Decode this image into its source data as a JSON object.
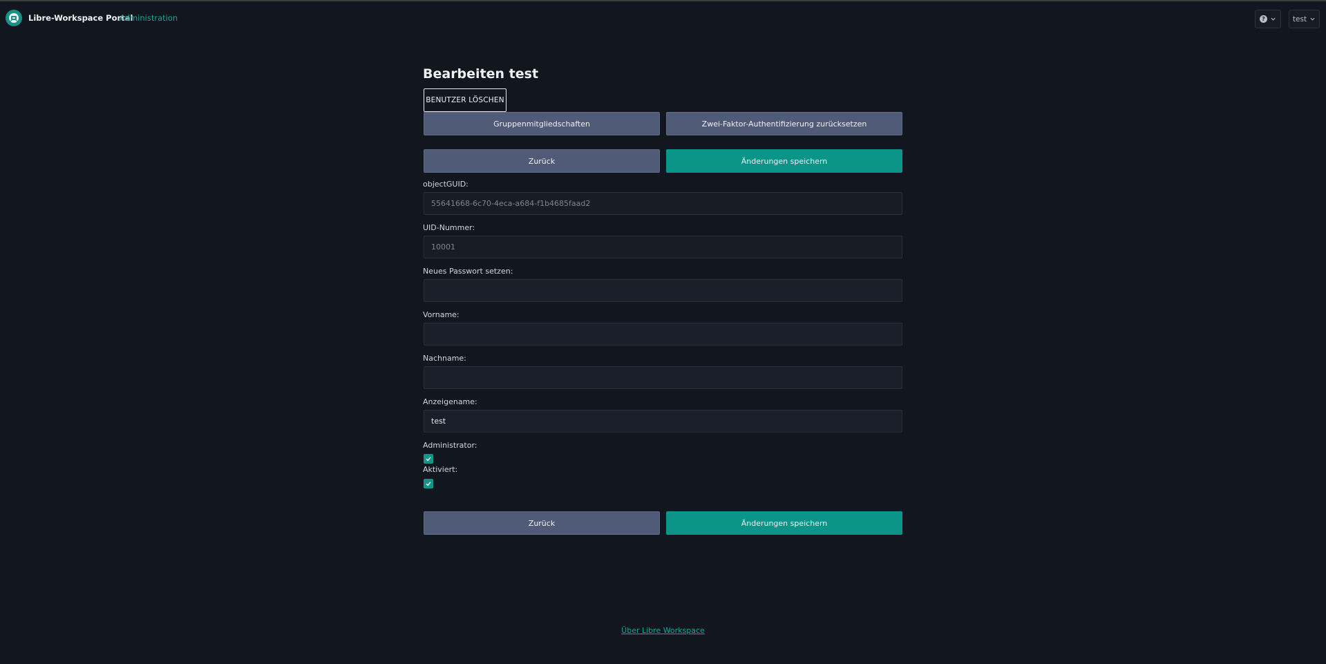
{
  "navbar": {
    "brand": "Libre-Workspace Portal",
    "admin_link": "Administration",
    "help_icon": "question-circle-icon",
    "user_label": "test"
  },
  "page": {
    "title": "Bearbeiten test",
    "delete_button": "BENUTZER LÖSCHEN",
    "group_memberships_button": "Gruppenmitgliedschaften",
    "reset_2fa_button": "Zwei-Faktor-Authentifizierung zurücksetzen",
    "back_button": "Zurück",
    "save_button": "Änderungen speichern"
  },
  "form": {
    "object_guid": {
      "label": "objectGUID:",
      "value": "55641668-6c70-4eca-a684-f1b4685faad2"
    },
    "uid_number": {
      "label": "UID-Nummer:",
      "value": "10001"
    },
    "new_password": {
      "label": "Neues Passwort setzen:",
      "value": ""
    },
    "first_name": {
      "label": "Vorname:",
      "value": ""
    },
    "last_name": {
      "label": "Nachname:",
      "value": ""
    },
    "display_name": {
      "label": "Anzeigename:",
      "value": "test"
    },
    "administrator": {
      "label": "Administrator:",
      "checked": true
    },
    "activated": {
      "label": "Aktiviert:",
      "checked": true
    }
  },
  "footer": {
    "about_link": "Über Libre Workspace"
  },
  "colors": {
    "background": "#12161e",
    "accent": "#0b9488",
    "secondary_button": "#4f5b77"
  }
}
